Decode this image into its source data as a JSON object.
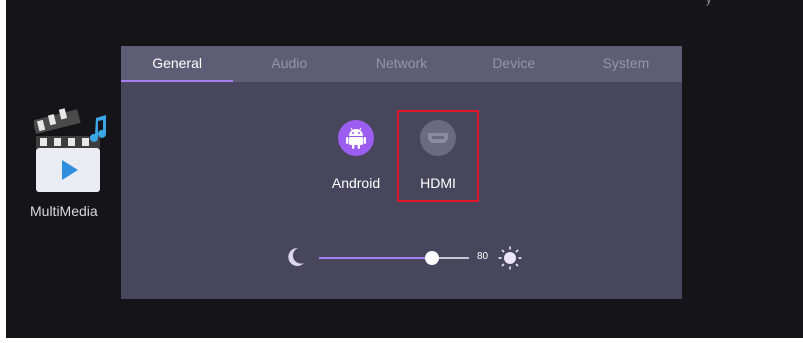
{
  "desktop": {
    "app_label": "MultiMedia"
  },
  "tabs": [
    {
      "label": "General",
      "active": true
    },
    {
      "label": "Audio",
      "active": false
    },
    {
      "label": "Network",
      "active": false
    },
    {
      "label": "Device",
      "active": false
    },
    {
      "label": "System",
      "active": false
    }
  ],
  "sources": {
    "android": {
      "label": "Android",
      "icon": "android-icon"
    },
    "hdmi": {
      "label": "HDMI",
      "icon": "hdmi-icon",
      "highlighted": true
    }
  },
  "brightness": {
    "value": "80",
    "level_percent": 75
  },
  "colors": {
    "accent": "#a77df0",
    "highlight": "#e0162b"
  }
}
